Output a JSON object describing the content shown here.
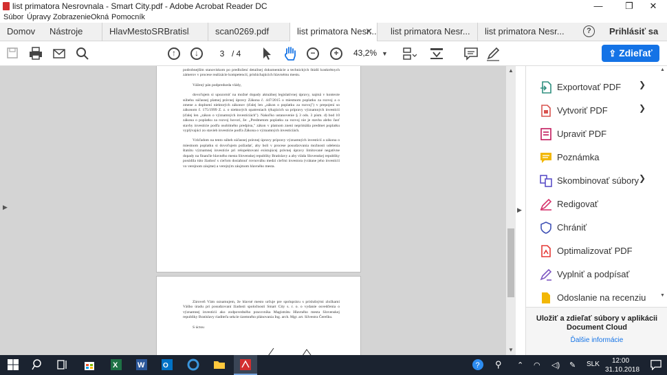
{
  "window": {
    "title": "list primatora Nesrovnala - Smart City.pdf - Adobe Acrobat Reader DC",
    "minimize": "—",
    "maximize": "❐",
    "close": "✕"
  },
  "menu": [
    "Súbor",
    "Úpravy",
    "Zobrazenie",
    "Okná",
    "Pomocník"
  ],
  "tabs": [
    {
      "label": "Domov"
    },
    {
      "label": "Nástroje"
    },
    {
      "label": "HlavMestoSRBratisl..."
    },
    {
      "label": "scan0269.pdf"
    },
    {
      "label": "list primatora Nesr...",
      "active": true
    },
    {
      "label": "list primatora Nesr..."
    },
    {
      "label": "list primatora Nesr..."
    }
  ],
  "help_icon": "?",
  "signin": "Prihlásiť sa",
  "toolbar": {
    "page_current": "3",
    "page_total": "/ 4",
    "zoom": "43,2%",
    "share_label": "Zdieľať"
  },
  "document": {
    "page1_paragraphs": [
      "podrobnejším stanoviskom po predložení detailnej dokumentácie a technických štúdií konkrétnych zámerov v procese realizácie kompetencií, prislúchajúcich hlavnému mestu.",
      "Vážený pán podpredseda vlády,",
      "dovoľujem si upozorniť na možné dopady aktuálnej legislatívnej úpravy, najmä v kontexte súbehu súčasnej platnej právnej úpravy Zákona č. 447/2015 o miestnom poplatku za rozvoj a o zmene a doplnení niektorých zákonov (ďalej len „zákon o poplatku za rozvoj\") v prepojení so zákonom č. 175/1999 Z. z. o niektorých opatreniach týkajúcich sa prípravy významných investícií (ďalej len „zákon o významných investíciách\"). Nakoľko ustanovenie § 3 ods. 3 písm. d) bod 10 zákona o poplatku za rozvoj hovorí, že: „Predmetom poplatku za rozvoj nie je stavba alebo časť stavby investície podľa osobitného predpisu,\" zákon v platnom znení neprimäňa predmet poplatku vyplývajúci zo stavieb investície podľa Zákona o významných investíciách.",
      "Vzhľadom na tento súbeh súčasnej právnej úpravy prípravy významných investícií a zákona o miestnom poplatku si dovoľujem požiadať, aby boli v procese posudzovania možnosti udelenia štatútu významnej investície pri relopektovaní existujúcej právnej úpravy limitované negatívne dopady na finančie hlavného mesta Slovenskej republiky Bratislavy a aby vláda Slovenskej republiky posúdila túto žiadosť s cieľom dosiahnuť rovnováhu medzi cieľmi investora (vrátane jeho investícií vo verejnom záujme) a verejným záujmom hlavného mesta."
    ],
    "page2_paragraphs": [
      "Zároveň Vám oznamujem, že hlavné mesto určuje pre spoluprácu s príslušnými zložkami Vášho úradu pri posudzovaní žiadosti spoločnosti Smart City s. r. o. o vydanie osvedčenia o významnej investícii ako zodpovedného pracovníka Magistrátu Hlavného mesta Slovenskej republiky Bratislavy riaditeľa sekcie územného plánovania Ing. arch. Mgr. art. Silvestra Čerešku.",
      "S úctou"
    ]
  },
  "tools": [
    {
      "label": "Exportovať PDF",
      "icon": "export-pdf-icon",
      "color": "#2f8f7f",
      "chevron": true
    },
    {
      "label": "Vytvoriť PDF",
      "icon": "create-pdf-icon",
      "color": "#d9534f",
      "chevron": true
    },
    {
      "label": "Upraviť PDF",
      "icon": "edit-pdf-icon",
      "color": "#c2185b",
      "chevron": false
    },
    {
      "label": "Poznámka",
      "icon": "comment-icon",
      "color": "#f2b705",
      "chevron": false
    },
    {
      "label": "Skombinovať súbory",
      "icon": "combine-files-icon",
      "color": "#5b4fc8",
      "chevron": true
    },
    {
      "label": "Redigovať",
      "icon": "redact-icon",
      "color": "#d6336c",
      "chevron": false
    },
    {
      "label": "Chrániť",
      "icon": "protect-icon",
      "color": "#3f51b5",
      "chevron": false
    },
    {
      "label": "Optimalizovať PDF",
      "icon": "optimize-pdf-icon",
      "color": "#e53935",
      "chevron": false
    },
    {
      "label": "Vyplniť a podpísať",
      "icon": "fill-sign-icon",
      "color": "#7e57c2",
      "chevron": false
    },
    {
      "label": "Odoslanie na recenziu",
      "icon": "send-review-icon",
      "color": "#f2b705",
      "chevron": false
    }
  ],
  "promo": {
    "text": "Uložiť a zdieľať súbory v aplikácii Document Cloud",
    "link": "Ďalšie informácie"
  },
  "taskbar": {
    "language": "SLK",
    "time": "12:00",
    "date": "31.10.2018"
  }
}
